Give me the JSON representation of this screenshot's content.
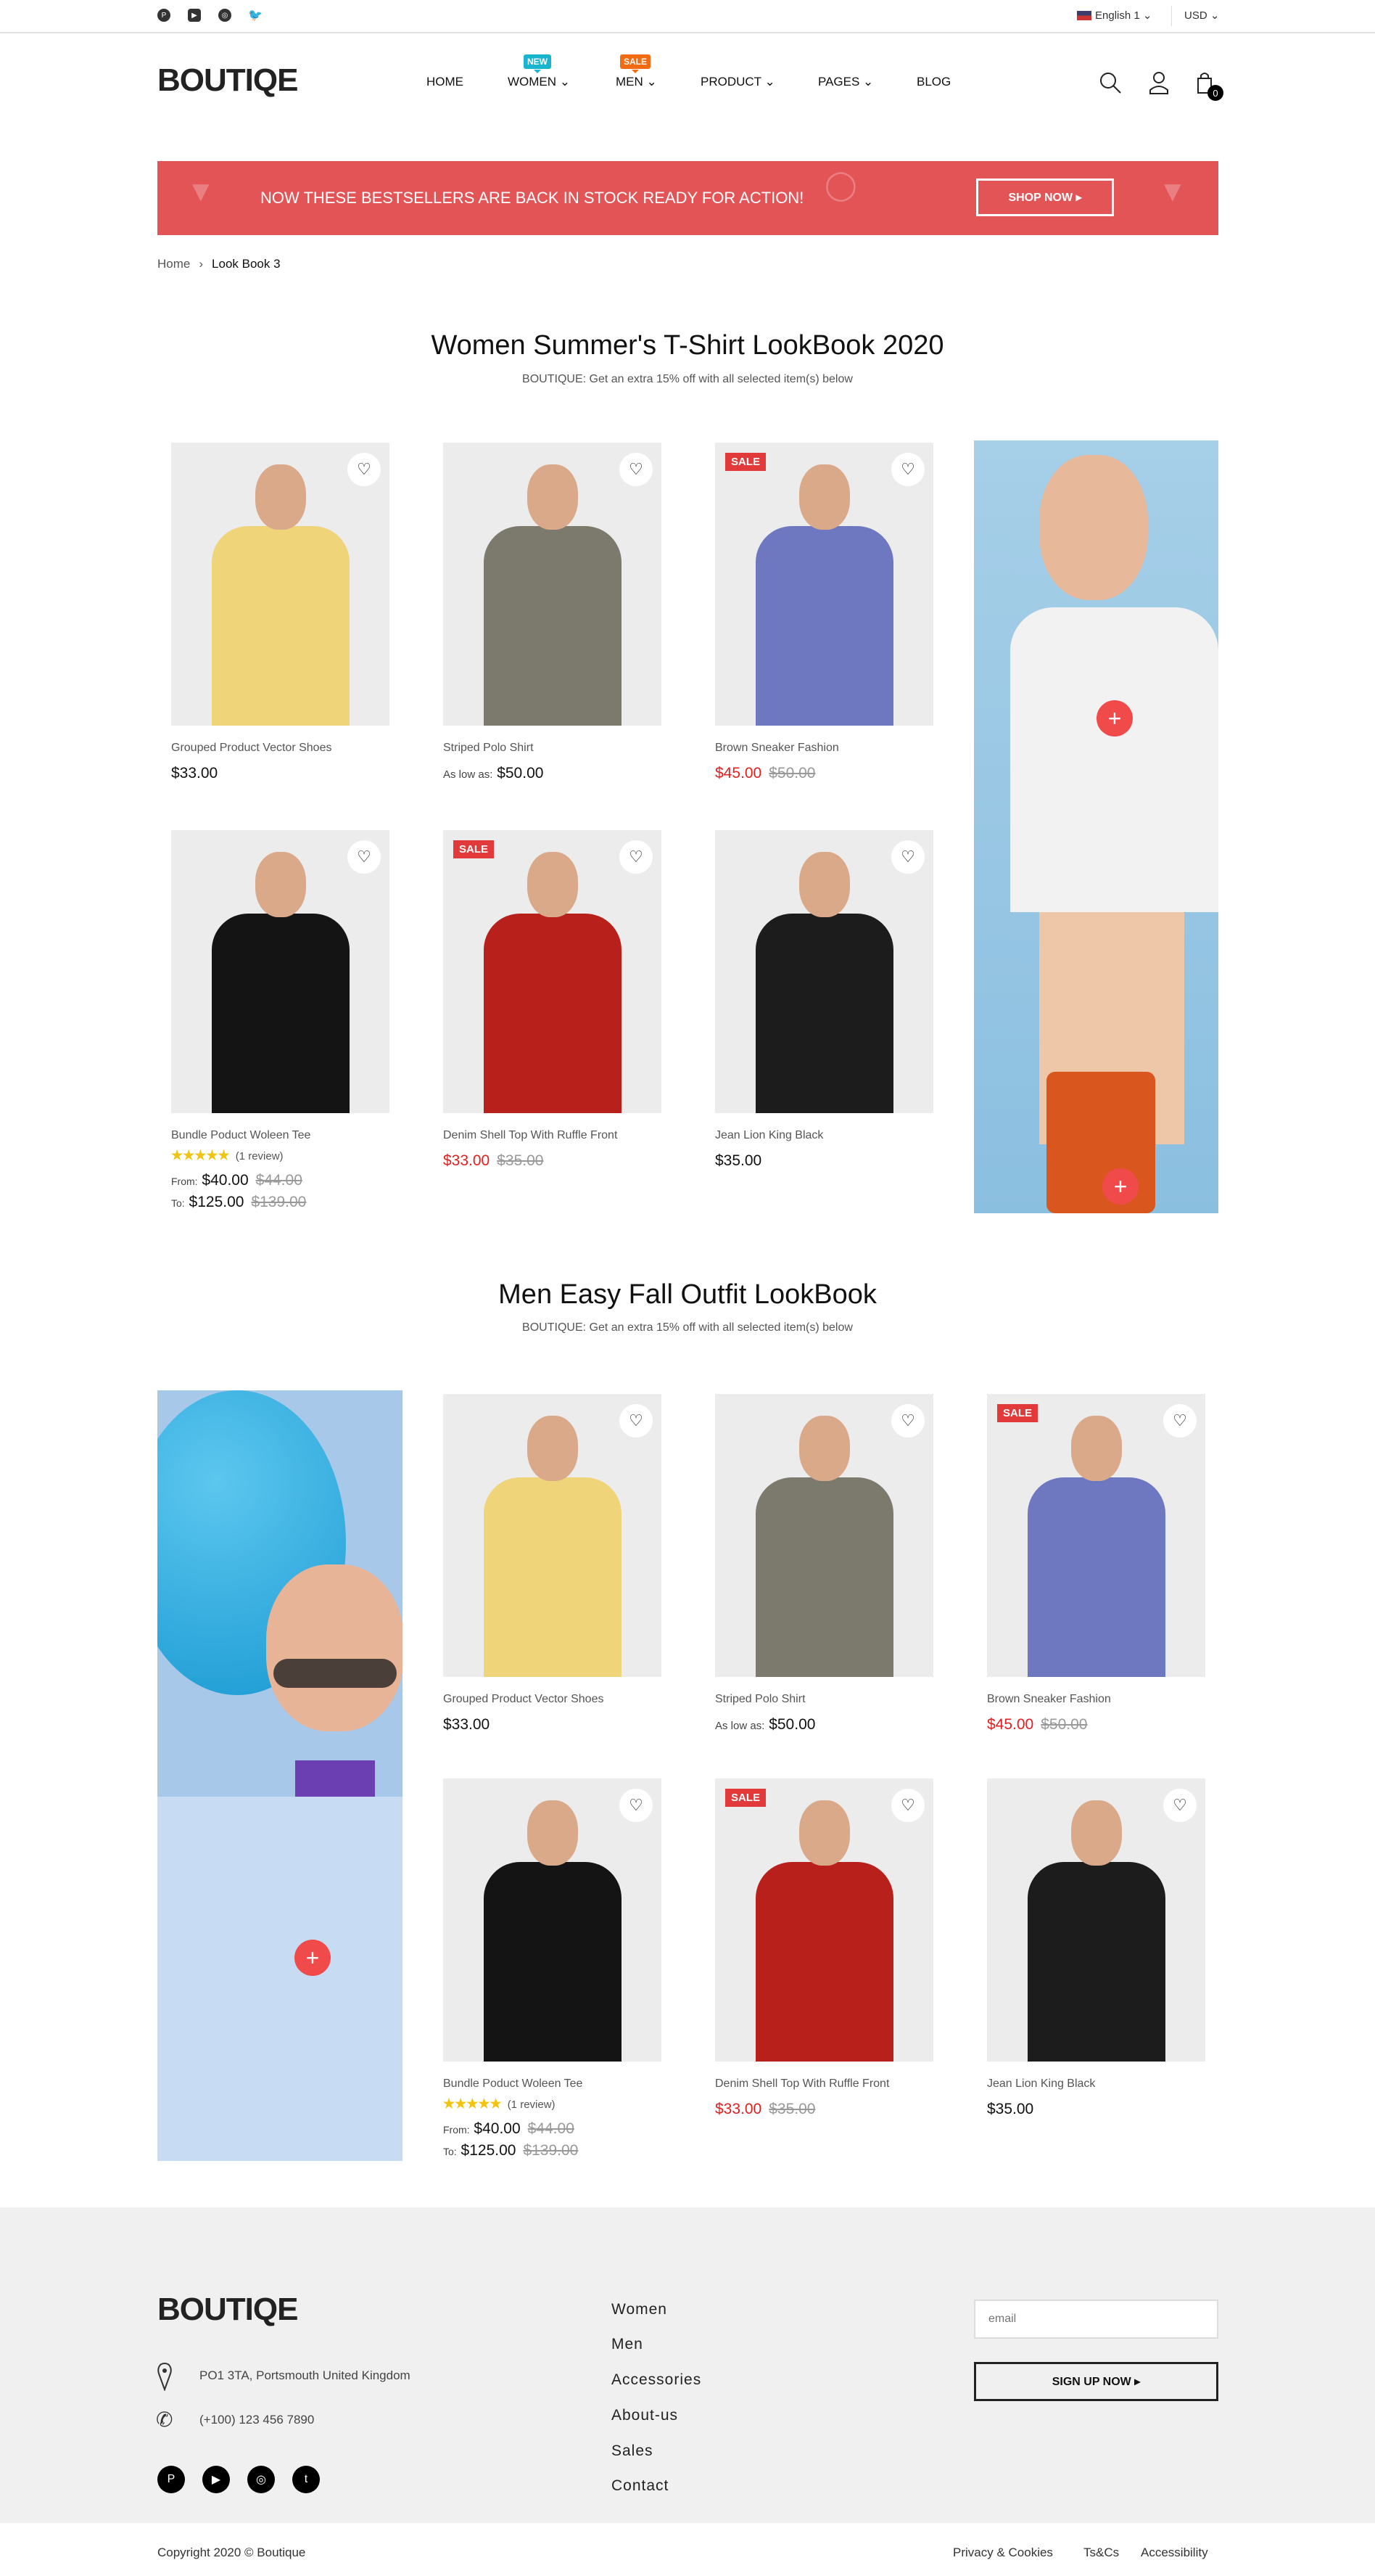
{
  "topbar": {
    "language": "English 1 ⌄",
    "currency": "USD ⌄",
    "social": [
      "pinterest-icon",
      "youtube-icon",
      "instagram-icon",
      "twitter-icon"
    ]
  },
  "header": {
    "logo": "BOUTIQE",
    "cart_count": "0",
    "nav": [
      {
        "label": "HOME"
      },
      {
        "label": "WOMEN ⌄",
        "badge": "NEW",
        "badge_color": "#19b5cf"
      },
      {
        "label": "MEN ⌄",
        "badge": "SALE",
        "badge_color": "#f26a12"
      },
      {
        "label": "PRODUCT ⌄"
      },
      {
        "label": "PAGES ⌄"
      },
      {
        "label": "BLOG"
      }
    ]
  },
  "banner": {
    "text": "NOW THESE BESTSELLERS ARE BACK IN STOCK READY FOR ACTION!",
    "button": "SHOP NOW ▸"
  },
  "breadcrumb": {
    "home": "Home",
    "sep": "›",
    "current": "Look Book 3"
  },
  "sections": [
    {
      "title": "Women Summer's T-Shirt LookBook 2020",
      "subtitle": "BOUTIQUE: Get an extra 15% off with all selected item(s) below"
    },
    {
      "title": "Men Easy Fall Outfit LookBook",
      "subtitle": "BOUTIQUE: Get an extra 15% off with all selected item(s) below"
    }
  ],
  "products": [
    {
      "name": "Grouped Product Vector Shoes",
      "price": "$33.00",
      "color": "#f0d47a"
    },
    {
      "name": "Striped Polo Shirt",
      "prefix": "As low as:",
      "price": "$50.00",
      "color": "#7b7a6c"
    },
    {
      "name": "Brown Sneaker Fashion",
      "price": "$45.00",
      "old": "$50.00",
      "sale": "SALE",
      "color": "#6e78c0"
    },
    {
      "name": "Bundle Poduct Woleen Tee",
      "stars": "★★★★★",
      "reviews": "(1 review)",
      "from_label": "From:",
      "from": "$40.00",
      "from_old": "$44.00",
      "to_label": "To:",
      "to": "$125.00",
      "to_old": "$139.00",
      "color": "#141414"
    },
    {
      "name": "Denim Shell Top With Ruffle Front",
      "price": "$33.00",
      "old": "$35.00",
      "sale": "SALE",
      "color": "#b8201c"
    },
    {
      "name": "Jean Lion King Black",
      "price": "$35.00",
      "color": "#1c1c1c"
    }
  ],
  "footer": {
    "logo": "BOUTIQE",
    "address": "PO1 3TA, Portsmouth United Kingdom",
    "phone": "(+100) 123 456 7890",
    "links": [
      "Women",
      "Men",
      "Accessories",
      "About-us",
      "Sales",
      "Contact"
    ],
    "email_placeholder": "email",
    "signup": "SIGN UP NOW ▸",
    "copyright": "Copyright 2020 © Boutique",
    "legal": [
      "Privacy & Cookies",
      "Ts&Cs",
      "Accessibility"
    ]
  },
  "colors": {
    "accent": "#e35457",
    "sale": "#e23a3a",
    "price_red": "#e02020"
  }
}
